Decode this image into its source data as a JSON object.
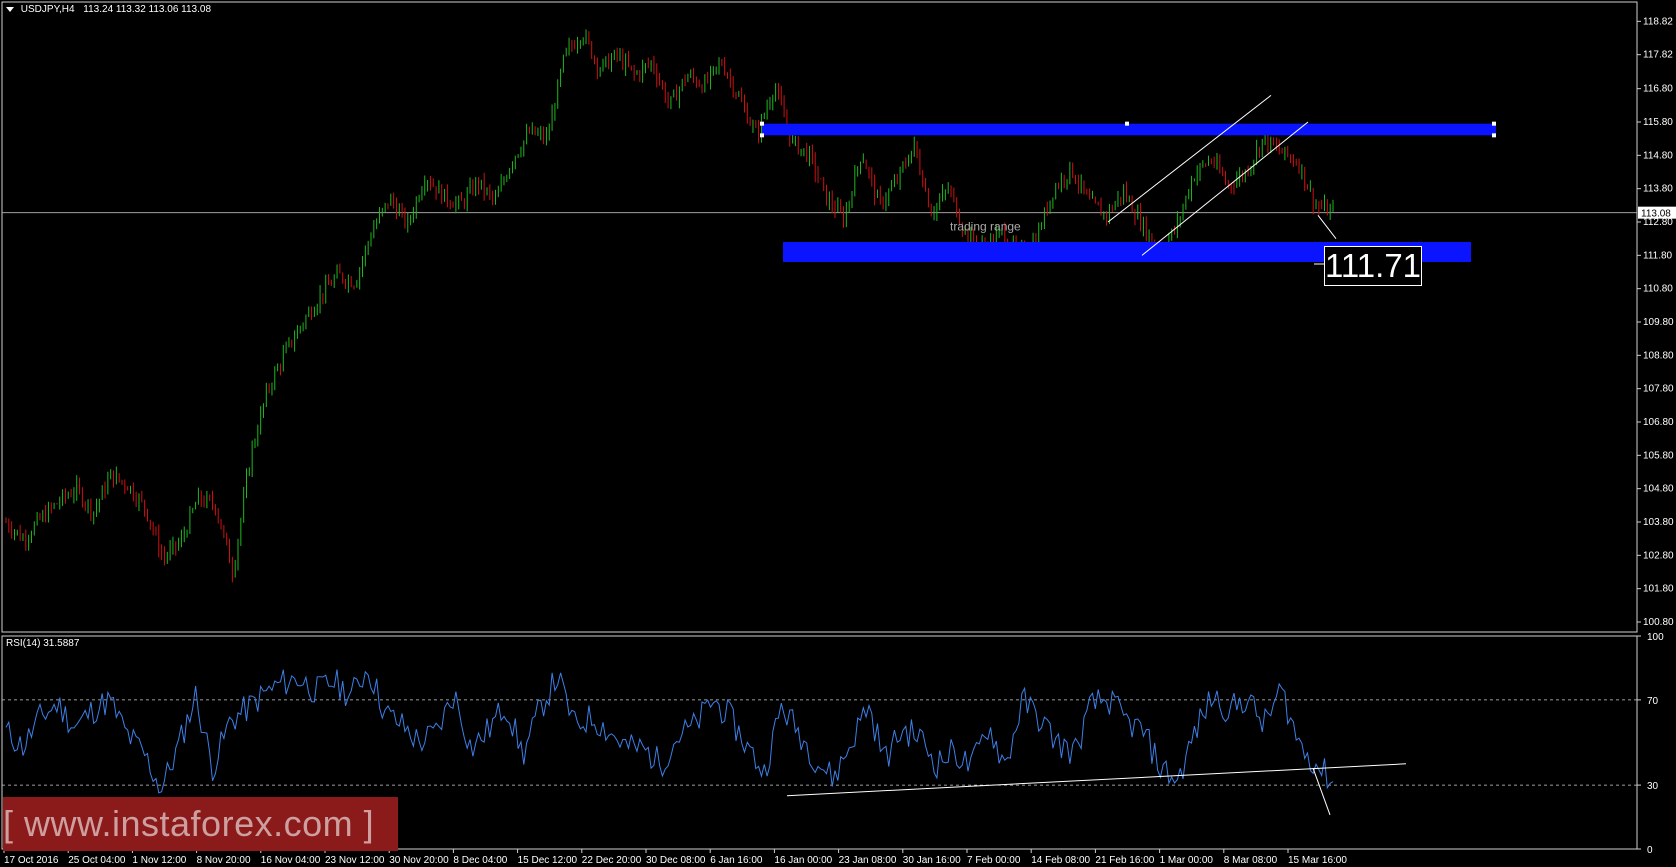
{
  "header": {
    "symbol": "USDJPY,H4",
    "ohlc": "113.24 113.32 113.06 113.08"
  },
  "rsi_header": "RSI(14) 31.5887",
  "annotations": {
    "trading_range": "trading range",
    "target_value": "111.71",
    "current_price_tag": "113.08"
  },
  "watermark": "[ www.instaforex.com ]",
  "colors": {
    "bull": "#1db81d",
    "bear": "#d01010",
    "zone": "#0a14ff",
    "rsi": "#3d7fe6",
    "grid": "#ffffff",
    "watermark_bg": "#8b1a1a"
  },
  "chart_data": [
    {
      "type": "candlestick",
      "title": "USDJPY,H4",
      "y_ticks": [
        118.82,
        117.82,
        116.8,
        115.8,
        114.8,
        113.8,
        112.8,
        111.8,
        110.8,
        109.8,
        108.8,
        107.8,
        106.8,
        105.8,
        104.8,
        103.8,
        102.8,
        101.8,
        100.8
      ],
      "ylim": [
        100.5,
        119.4
      ],
      "x_ticks": [
        "17 Oct 2016",
        "25 Oct 04:00",
        "1 Nov 12:00",
        "8 Nov 20:00",
        "16 Nov 04:00",
        "23 Nov 12:00",
        "30 Nov 20:00",
        "8 Dec 04:00",
        "15 Dec 12:00",
        "22 Dec 20:00",
        "30 Dec 08:00",
        "6 Jan 16:00",
        "16 Jan 00:00",
        "23 Jan 08:00",
        "30 Jan 16:00",
        "7 Feb 00:00",
        "14 Feb 08:00",
        "21 Feb 16:00",
        "1 Mar 00:00",
        "8 Mar 08:00",
        "15 Mar 16:00"
      ],
      "close_path": [
        103.8,
        103.3,
        103.9,
        104.4,
        104.8,
        104.1,
        105.2,
        104.9,
        104.2,
        102.7,
        103.2,
        104.5,
        104.3,
        102.3,
        105.8,
        107.8,
        108.9,
        109.8,
        110.6,
        111.2,
        111.0,
        112.6,
        113.5,
        112.7,
        114.2,
        113.6,
        113.3,
        114.0,
        113.4,
        114.7,
        115.5,
        115.3,
        117.8,
        118.5,
        117.4,
        117.8,
        117.2,
        117.6,
        116.3,
        117.2,
        116.9,
        117.6,
        116.5,
        115.4,
        116.9,
        115.2,
        114.8,
        113.5,
        112.9,
        114.9,
        113.3,
        114.0,
        115.1,
        113.1,
        113.8,
        112.4,
        112.0,
        112.5,
        111.8,
        112.3,
        113.8,
        114.4,
        113.4,
        113.0,
        113.7,
        112.8,
        111.9,
        112.6,
        114.2,
        114.7,
        113.9,
        114.3,
        115.3,
        114.9,
        114.6,
        113.3,
        113.08
      ],
      "price_level": 113.08,
      "zones": [
        {
          "from": 115.4,
          "to": 115.75
        },
        {
          "from": 111.6,
          "to": 112.2
        }
      ],
      "target": 111.71
    },
    {
      "type": "line",
      "title": "RSI(14) 31.5887",
      "y_ticks": [
        100,
        70,
        30,
        0
      ],
      "levels": [
        70,
        30
      ],
      "ylim": [
        0,
        100
      ],
      "values_path": [
        55,
        48,
        62,
        68,
        57,
        65,
        70,
        54,
        45,
        28,
        48,
        72,
        38,
        60,
        66,
        73,
        78,
        80,
        74,
        79,
        72,
        85,
        64,
        58,
        50,
        55,
        73,
        47,
        56,
        68,
        44,
        66,
        81,
        58,
        62,
        55,
        48,
        47,
        40,
        53,
        58,
        70,
        62,
        48,
        36,
        67,
        55,
        42,
        33,
        49,
        68,
        42,
        56,
        53,
        40,
        46,
        38,
        58,
        39,
        70,
        61,
        50,
        45,
        68,
        70,
        60,
        55,
        38,
        32,
        55,
        72,
        65,
        71,
        58,
        75,
        50,
        40,
        31.6
      ]
    }
  ]
}
